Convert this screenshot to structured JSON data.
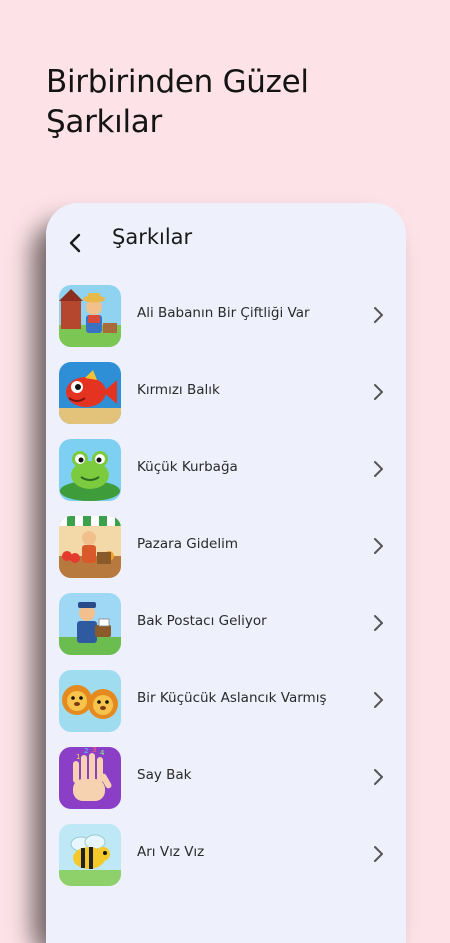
{
  "headline": {
    "line1": "Birbirinden Güzel",
    "line2": "Şarkılar"
  },
  "appbar": {
    "back_icon": "chevron-left-icon",
    "title": "Şarkılar"
  },
  "songs": [
    {
      "label": "Ali Babanın Bir Çiftliği Var",
      "icon": "farmer-thumbnail"
    },
    {
      "label": "Kırmızı Balık",
      "icon": "red-fish-thumbnail"
    },
    {
      "label": "Küçük Kurbağa",
      "icon": "frog-thumbnail"
    },
    {
      "label": "Pazara Gidelim",
      "icon": "market-thumbnail"
    },
    {
      "label": "Bak Postacı Geliyor",
      "icon": "postman-thumbnail"
    },
    {
      "label": "Bir Küçücük Aslancık Varmış",
      "icon": "lion-thumbnail"
    },
    {
      "label": "Say Bak",
      "icon": "counting-hand-thumbnail"
    },
    {
      "label": "Arı Vız Vız",
      "icon": "bee-thumbnail"
    }
  ],
  "colors": {
    "page_background": "#fde3e7",
    "card_background": "#eef0fb",
    "text": "#1a1a1a",
    "chevron": "#555555"
  }
}
